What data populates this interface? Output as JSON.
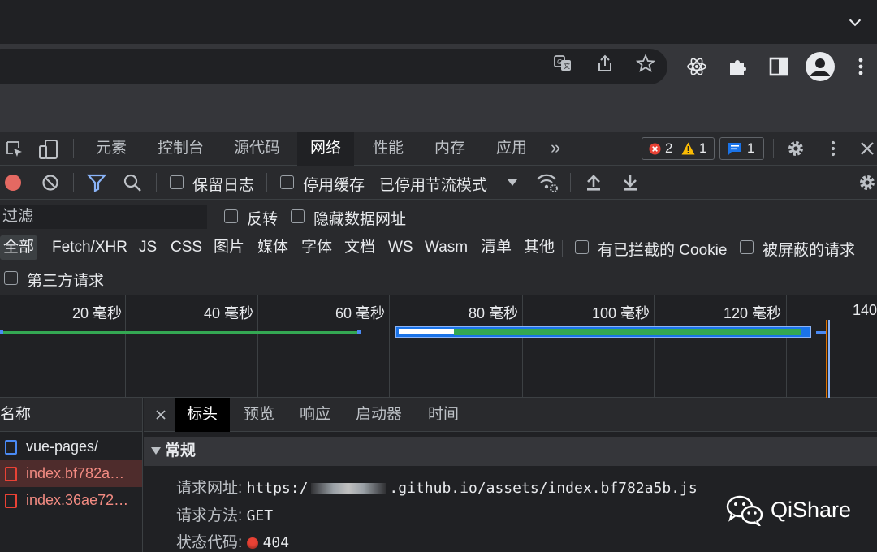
{
  "devtools": {
    "tabs": [
      "元素",
      "控制台",
      "源代码",
      "网络",
      "性能",
      "内存",
      "应用"
    ],
    "active_tab": "网络",
    "errors_count": "2",
    "warnings_count": "1",
    "messages_count": "1"
  },
  "network_toolbar": {
    "preserve_log": "保留日志",
    "disable_cache": "停用缓存",
    "throttling": "已停用节流模式"
  },
  "filter": {
    "placeholder": "过滤",
    "invert": "反转",
    "hide_data_urls": "隐藏数据网址",
    "types": [
      "全部",
      "Fetch/XHR",
      "JS",
      "CSS",
      "图片",
      "媒体",
      "字体",
      "文档",
      "WS",
      "Wasm",
      "清单",
      "其他"
    ],
    "active_type": "全部",
    "blocked_cookies": "有已拦截的 Cookie",
    "blocked_requests": "被屏蔽的请求",
    "third_party": "第三方请求"
  },
  "timeline": {
    "ticks": [
      "20 毫秒",
      "40 毫秒",
      "60 毫秒",
      "80 毫秒",
      "100 毫秒",
      "120 毫秒",
      "140"
    ]
  },
  "requests": {
    "header": "名称",
    "items": [
      "vue-pages/",
      "index.bf782a…",
      "index.36ae72…"
    ]
  },
  "details": {
    "tabs": [
      "标头",
      "预览",
      "响应",
      "启动器",
      "时间"
    ],
    "active_tab": "标头",
    "section": "常规",
    "request_url_label": "请求网址:",
    "request_url_prefix": "https:/",
    "request_url_suffix": ".github.io/assets/index.bf782a5b.js",
    "request_method_label": "请求方法:",
    "request_method": "GET",
    "status_code_label": "状态代码:",
    "status_code": "404"
  },
  "watermark": "QiShare",
  "colors": {
    "error": "#e94235",
    "accent_blue": "#8ab4f8",
    "timing_green": "#34a853"
  }
}
